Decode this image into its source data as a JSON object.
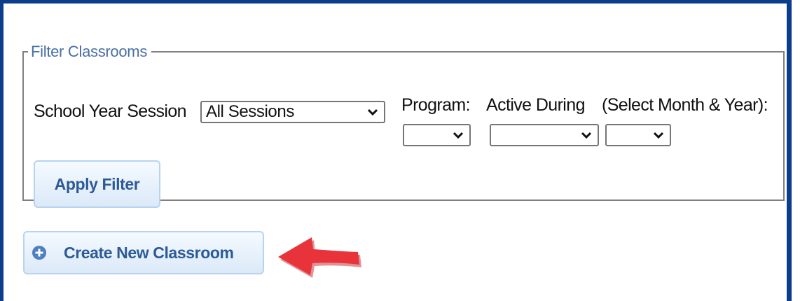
{
  "filter": {
    "legend": "Filter Classrooms",
    "school_year_label": "School Year Session",
    "school_year_value": "All Sessions",
    "program_label": "Program:",
    "program_value": "",
    "active_during_label": "Active During",
    "select_month_year_label": "(Select Month & Year):",
    "month_value": "",
    "year_value": "",
    "apply_label": "Apply Filter"
  },
  "create_button": {
    "label": "Create New Classroom",
    "icon": "plus-circle-icon"
  },
  "annotation": {
    "arrow_color": "#e8333a",
    "icon": "arrow-left-icon"
  },
  "colors": {
    "frame_border": "#0b3d8c",
    "button_text": "#2b5a96",
    "legend_text": "#4a6fa5"
  }
}
